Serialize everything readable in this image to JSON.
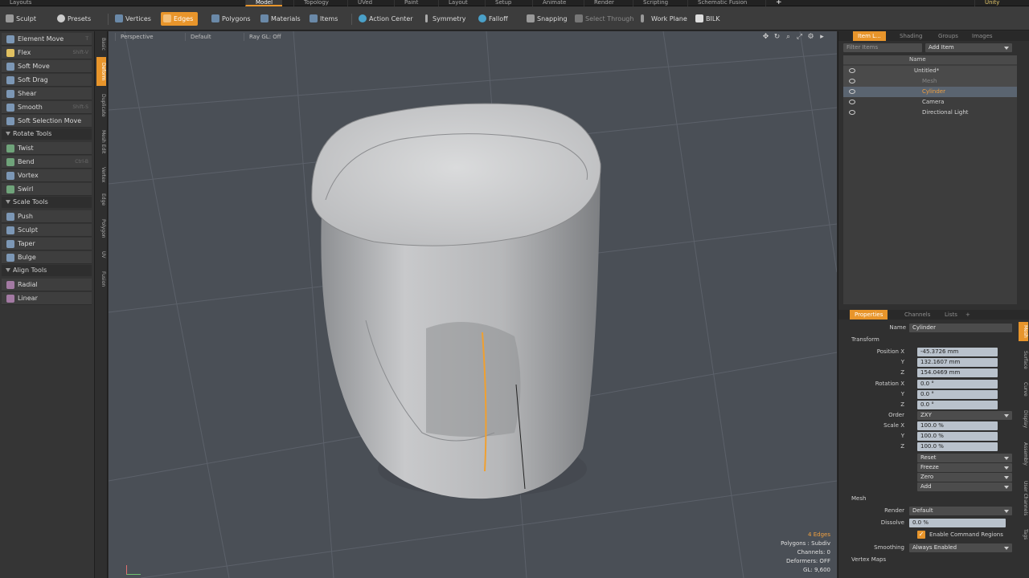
{
  "menubar": {
    "left_label": "Layouts",
    "tabs": [
      "Model",
      "Topology",
      "UVed",
      "Paint",
      "Layout",
      "Setup",
      "Animate",
      "Render",
      "Scripting",
      "Schematic Fusion"
    ],
    "active_tab": "Model",
    "right_label": "Unity",
    "add_label": "+"
  },
  "toolbar": {
    "sculpt": "Sculpt",
    "presets": "Presets",
    "vertices": "Vertices",
    "edges": "Edges",
    "polygons": "Polygons",
    "materials": "Materials",
    "items": "Items",
    "action_center": "Action Center",
    "symmetry": "Symmetry",
    "falloff": "Falloff",
    "snapping": "Snapping",
    "select_through": "Select Through",
    "work_plane": "Work Plane",
    "bilk": "BILK"
  },
  "leftpanel": {
    "tools": [
      {
        "label": "Element Move",
        "key": "T"
      },
      {
        "label": "Flex",
        "key": "Shift-V"
      },
      {
        "label": "Soft Move",
        "key": ""
      },
      {
        "label": "Soft Drag",
        "key": ""
      },
      {
        "label": "Shear",
        "key": ""
      },
      {
        "label": "Smooth",
        "key": "Shift-S"
      },
      {
        "label": "Soft Selection Move",
        "key": ""
      }
    ],
    "rotate_header": "Rotate Tools",
    "rotate_tools": [
      {
        "label": "Twist",
        "key": ""
      },
      {
        "label": "Bend",
        "key": "Ctrl-B"
      },
      {
        "label": "Vortex",
        "key": ""
      },
      {
        "label": "Swirl",
        "key": ""
      }
    ],
    "scale_header": "Scale Tools",
    "scale_tools": [
      {
        "label": "Push",
        "key": ""
      },
      {
        "label": "Sculpt",
        "key": ""
      },
      {
        "label": "Taper",
        "key": ""
      },
      {
        "label": "Bulge",
        "key": ""
      }
    ],
    "align_header": "Align Tools",
    "align_tools": [
      {
        "label": "Radial",
        "key": ""
      },
      {
        "label": "Linear",
        "key": ""
      }
    ],
    "vtabs": [
      "Basic",
      "Deform",
      "Duplicate",
      "Mesh Edit",
      "Vertex",
      "Edge",
      "Polygon",
      "UV",
      "Fusion"
    ]
  },
  "viewport": {
    "labels": [
      "Perspective",
      "Default",
      "Ray GL: Off"
    ],
    "stats": {
      "edges": "4 Edges",
      "polygons": "Polygons : Subdiv",
      "channels": "Channels: 0",
      "deformers": "Deformers: OFF",
      "gl": "GL: 9,600"
    }
  },
  "items_panel": {
    "tabs": [
      "Item L...",
      "Shading",
      "Groups",
      "Images"
    ],
    "active_tab": "Item L...",
    "filter_placeholder": "Filter Items",
    "add_item": "Add Item",
    "column_name": "Name",
    "items": [
      {
        "label": "Untitled*"
      },
      {
        "label": "Mesh"
      },
      {
        "label": "Cylinder"
      },
      {
        "label": "Camera"
      },
      {
        "label": "Directional Light"
      }
    ],
    "selected_item": "Cylinder"
  },
  "properties": {
    "tabs": [
      "Properties",
      "Channels",
      "Lists"
    ],
    "active_tab": "Properties",
    "add_tab": "+",
    "name_label": "Name",
    "name_value": "Cylinder",
    "transform_header": "Transform",
    "position_label": "Position X",
    "position": [
      "-45.3726 mm",
      "132.1607 mm",
      "154.0469 mm"
    ],
    "rotation_label": "Rotation X",
    "rotation": [
      "0.0 °",
      "0.0 °",
      "0.0 °"
    ],
    "order_label": "Order",
    "order_value": "ZXY",
    "scale_label": "Scale X",
    "scale": [
      "100.0 %",
      "100.0 %",
      "100.0 %"
    ],
    "axis_y": "Y",
    "axis_z": "Z",
    "actions": [
      "Reset",
      "Freeze",
      "Zero",
      "Add"
    ],
    "mesh_header": "Mesh",
    "render_label": "Render",
    "render_value": "Default",
    "dissolve_label": "Dissolve",
    "dissolve_value": "0.0 %",
    "enable_cmd_label": "Enable Command Regions",
    "smoothing_label": "Smoothing",
    "smoothing_value": "Always Enabled",
    "vertex_maps_header": "Vertex Maps",
    "side_tabs": [
      "Mesh",
      "Surface",
      "Curve",
      "Display",
      "Assembly",
      "User Channels",
      "Tags"
    ]
  },
  "colors": {
    "accent": "#e8952b",
    "viewport_bg": "#4a4f56",
    "panel_bg": "#353535"
  }
}
